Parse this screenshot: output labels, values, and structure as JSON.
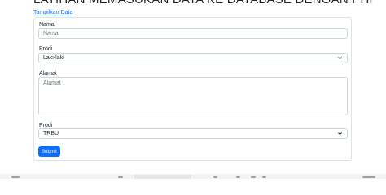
{
  "page": {
    "title": "LATIHAN MEMASUKAN DATA KE DATABASE DENGAN PHP",
    "link_label": "Tampilkan Data"
  },
  "form": {
    "nama_label": "Nama",
    "nama_placeholder": "Nama",
    "prodi_label": "Prodi",
    "prodi_selected": "Laki-laki",
    "alamat_label": "Alamat",
    "alamat_placeholder": "Alamat",
    "prodi2_label": "Prodi",
    "prodi2_selected": "TRBU",
    "submit_label": "Submit"
  },
  "colors": {
    "accent": "#0d6efd",
    "border": "#ced4da"
  },
  "icons": {
    "select_arrow": "chevron-down-icon"
  }
}
